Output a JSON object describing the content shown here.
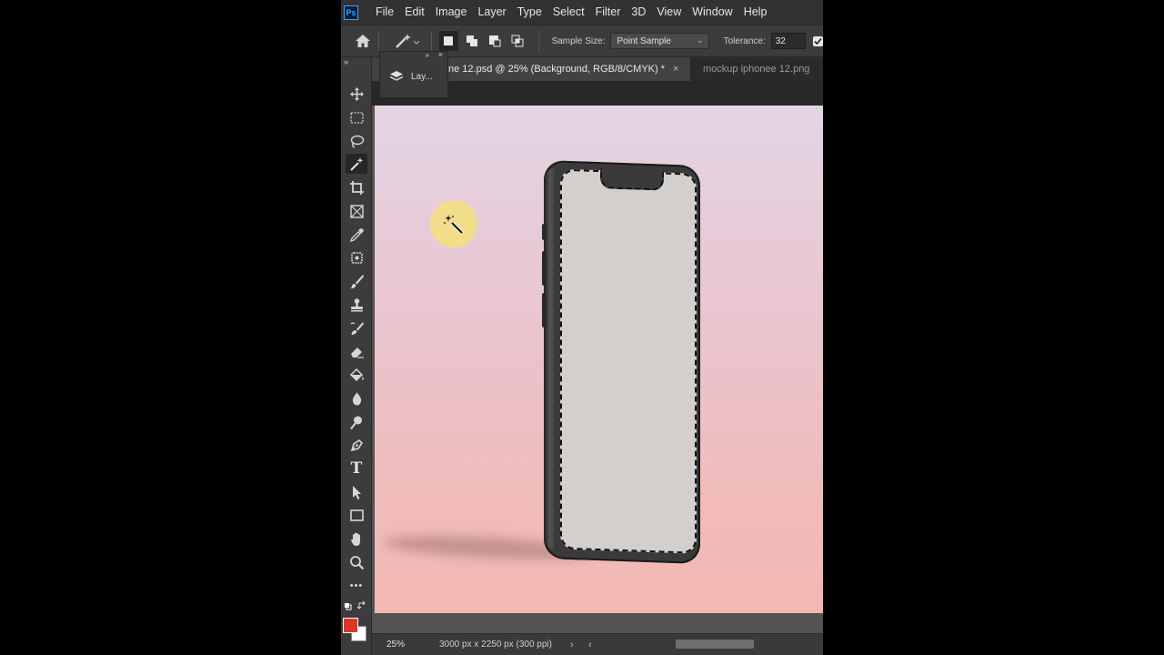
{
  "app": {
    "logo": "Ps",
    "menu": [
      "File",
      "Edit",
      "Image",
      "Layer",
      "Type",
      "Select",
      "Filter",
      "3D",
      "View",
      "Window",
      "Help"
    ]
  },
  "options": {
    "sample_size_label": "Sample Size:",
    "sample_size_value": "Point Sample",
    "tolerance_label": "Tolerance:",
    "tolerance_value": "32",
    "icons": [
      "home-icon",
      "magic-wand-icon",
      "new-selection-icon",
      "add-selection-icon",
      "subtract-selection-icon",
      "intersect-selection-icon"
    ]
  },
  "tabs": [
    {
      "label": "ne 12.psd @ 25% (Background, RGB/8/CMYK) *",
      "close": "×",
      "active": true
    },
    {
      "label": "mockup iphonee 12.png",
      "active": false
    }
  ],
  "layers_panel": {
    "label": "Lay...",
    "collapse": "»",
    "close": "×"
  },
  "toolbar": {
    "collapse": "»",
    "tools": [
      "move-tool",
      "marquee-tool",
      "lasso-tool",
      "magic-wand-tool",
      "crop-tool",
      "frame-tool",
      "eyedropper-tool",
      "healing-tool",
      "brush-tool",
      "stamp-tool",
      "history-brush-tool",
      "eraser-tool",
      "paint-bucket-tool",
      "blur-tool",
      "dodge-tool",
      "pen-tool",
      "type-tool",
      "path-select-tool",
      "rectangle-tool",
      "hand-tool",
      "zoom-tool",
      "more-tools"
    ],
    "type_glyph": "T",
    "more_glyph": "•••",
    "active_tool": "magic-wand-tool",
    "foreground_color": "#d9372b",
    "background_color": "#ffffff"
  },
  "status": {
    "zoom": "25%",
    "doc_info": "3000 px x 2250 px (300 ppi)",
    "arrow_right": "›",
    "arrow_left": "‹"
  },
  "colors": {
    "accent": "#31a8ff",
    "panel": "#3c3c3c",
    "canvas_top": "#e3d4e3",
    "canvas_bottom": "#f2b8b2"
  }
}
